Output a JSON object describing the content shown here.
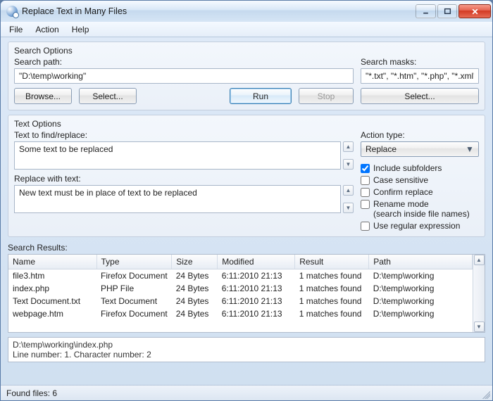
{
  "window": {
    "title": "Replace Text in Many Files"
  },
  "menu": {
    "file": "File",
    "action": "Action",
    "help": "Help"
  },
  "search_options": {
    "group_title": "Search Options",
    "path_label": "Search path:",
    "path_value": "\"D:\\temp\\working\"",
    "masks_label": "Search masks:",
    "masks_value": "\"*.txt\", \"*.htm\", \"*.php\", \"*.xml\"",
    "browse": "Browse...",
    "select_left": "Select...",
    "run": "Run",
    "stop": "Stop",
    "select_right": "Select..."
  },
  "text_options": {
    "group_title": "Text Options",
    "find_label": "Text to find/replace:",
    "find_value": "Some text to be replaced",
    "replace_label": "Replace with text:",
    "replace_value": "New text must be in place of text to be replaced",
    "action_type_label": "Action type:",
    "action_type_value": "Replace",
    "include_subfolders": "Include subfolders",
    "case_sensitive": "Case sensitive",
    "confirm_replace": "Confirm replace",
    "rename_mode_line1": "Rename mode",
    "rename_mode_line2": "(search inside file names)",
    "use_regex": "Use regular expression",
    "checks": {
      "include_subfolders": true,
      "case_sensitive": false,
      "confirm_replace": false,
      "rename_mode": false,
      "use_regex": false
    }
  },
  "results": {
    "label": "Search Results:",
    "columns": {
      "name": "Name",
      "type": "Type",
      "size": "Size",
      "modified": "Modified",
      "result": "Result",
      "path": "Path"
    },
    "rows": [
      {
        "name": "file3.htm",
        "type": "Firefox Document",
        "size": "24 Bytes",
        "modified": "6:11:2010  21:13",
        "result": "1 matches found",
        "path": "D:\\temp\\working"
      },
      {
        "name": "index.php",
        "type": "PHP File",
        "size": "24 Bytes",
        "modified": "6:11:2010  21:13",
        "result": "1 matches found",
        "path": "D:\\temp\\working"
      },
      {
        "name": "Text Document.txt",
        "type": "Text Document",
        "size": "24 Bytes",
        "modified": "6:11:2010  21:13",
        "result": "1 matches found",
        "path": "D:\\temp\\working"
      },
      {
        "name": "webpage.htm",
        "type": "Firefox Document",
        "size": "24 Bytes",
        "modified": "6:11:2010  21:13",
        "result": "1 matches found",
        "path": "D:\\temp\\working"
      }
    ]
  },
  "detail": {
    "line1": "D:\\temp\\working\\index.php",
    "line2": "Line number: 1. Character number: 2"
  },
  "status": {
    "text": "Found files: 6"
  }
}
